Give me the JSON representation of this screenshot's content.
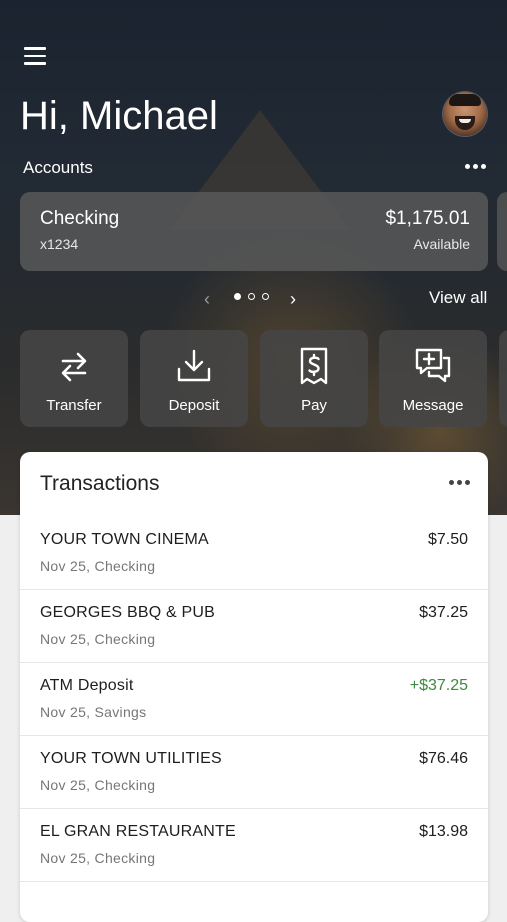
{
  "header": {
    "greeting": "Hi, Michael",
    "accounts_label": "Accounts",
    "view_all": "View all",
    "pager": {
      "pages": 3,
      "active_page": 1
    }
  },
  "account": {
    "name": "Checking",
    "number": "x1234",
    "balance": "$1,175.01",
    "balance_label": "Available"
  },
  "actions": [
    {
      "label": "Transfer",
      "icon": "transfer-arrows-icon"
    },
    {
      "label": "Deposit",
      "icon": "download-tray-icon"
    },
    {
      "label": "Pay",
      "icon": "receipt-dollar-icon"
    },
    {
      "label": "Message",
      "icon": "chat-plus-icon"
    }
  ],
  "transactions": {
    "title": "Transactions",
    "items": [
      {
        "description": "YOUR TOWN CINEMA",
        "meta": "Nov 25, Checking",
        "amount": "$7.50",
        "positive": false
      },
      {
        "description": "GEORGES BBQ & PUB",
        "meta": "Nov 25, Checking",
        "amount": "$37.25",
        "positive": false
      },
      {
        "description": "ATM Deposit",
        "meta": "Nov 25, Savings",
        "amount": "+$37.25",
        "positive": true
      },
      {
        "description": "YOUR TOWN UTILITIES",
        "meta": "Nov 25, Checking",
        "amount": "$76.46",
        "positive": false
      },
      {
        "description": "EL GRAN RESTAURANTE",
        "meta": "Nov 25, Checking",
        "amount": "$13.98",
        "positive": false
      }
    ]
  },
  "colors": {
    "positive_amount": "#3d8b3d",
    "card_background": "#ffffff",
    "hero_dark": "#1b2330"
  }
}
